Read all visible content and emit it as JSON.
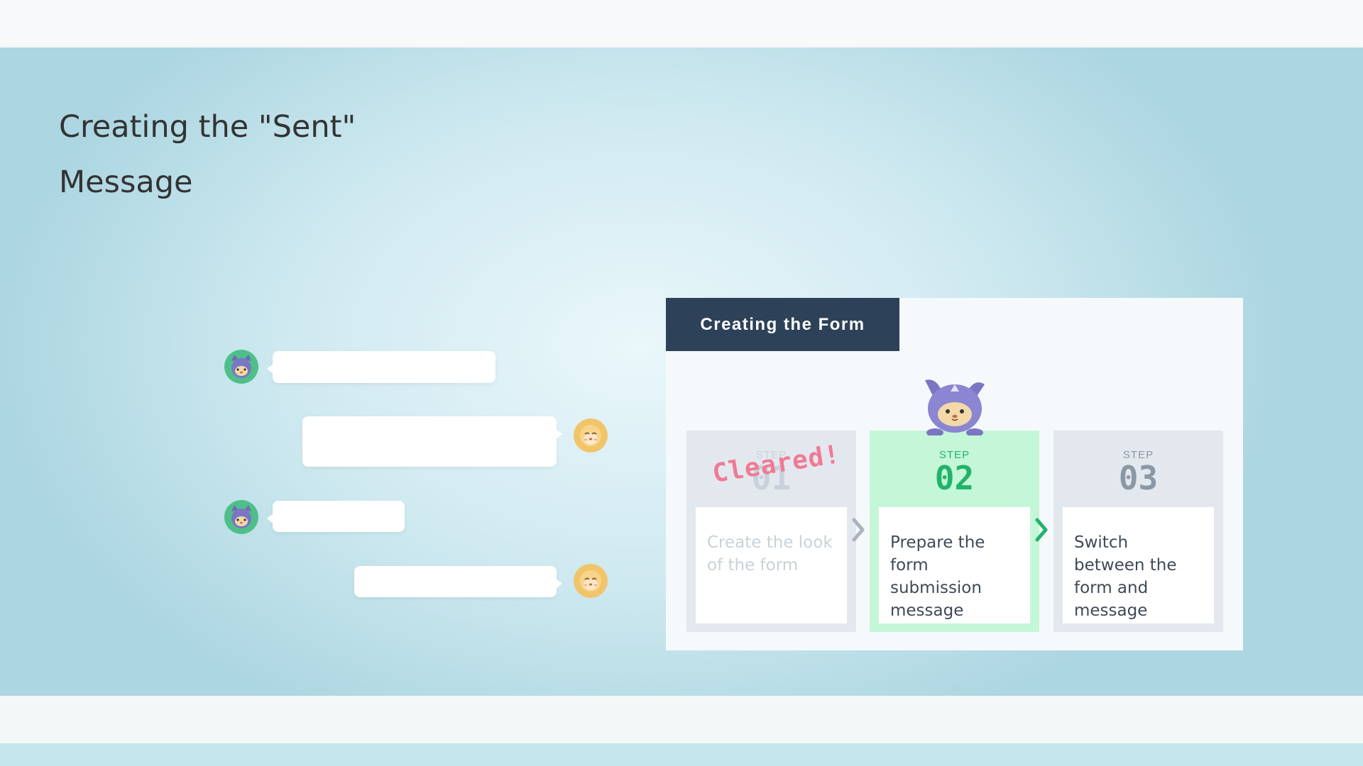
{
  "page": {
    "title": "Creating the \"Sent\" Message"
  },
  "chat": {
    "messages": [
      {
        "sender": "cat",
        "side": "left"
      },
      {
        "sender": "dog",
        "side": "right"
      },
      {
        "sender": "cat",
        "side": "left"
      },
      {
        "sender": "dog",
        "side": "right"
      }
    ]
  },
  "panel": {
    "header": "Creating the Form",
    "badge": "Cleared!",
    "steps": [
      {
        "label": "STEP",
        "number": "01",
        "text": "Create the look of the form",
        "state": "done"
      },
      {
        "label": "STEP",
        "number": "02",
        "text": "Prepare the form submission message",
        "state": "active"
      },
      {
        "label": "STEP",
        "number": "03",
        "text": "Switch between the form and message",
        "state": "upcoming"
      }
    ]
  },
  "colors": {
    "header_bg": "#2d4258",
    "active_step": "#c4f7d7",
    "active_accent": "#22b36b",
    "cleared": "#f07a95",
    "cat_avatar": "#4fbf8a",
    "dog_avatar": "#f2c46a"
  },
  "icons": {
    "cat_avatar": "cat-avatar-icon",
    "dog_avatar": "dog-avatar-icon",
    "mascot": "mascot-cat-icon",
    "chevron": "chevron-right-icon"
  }
}
